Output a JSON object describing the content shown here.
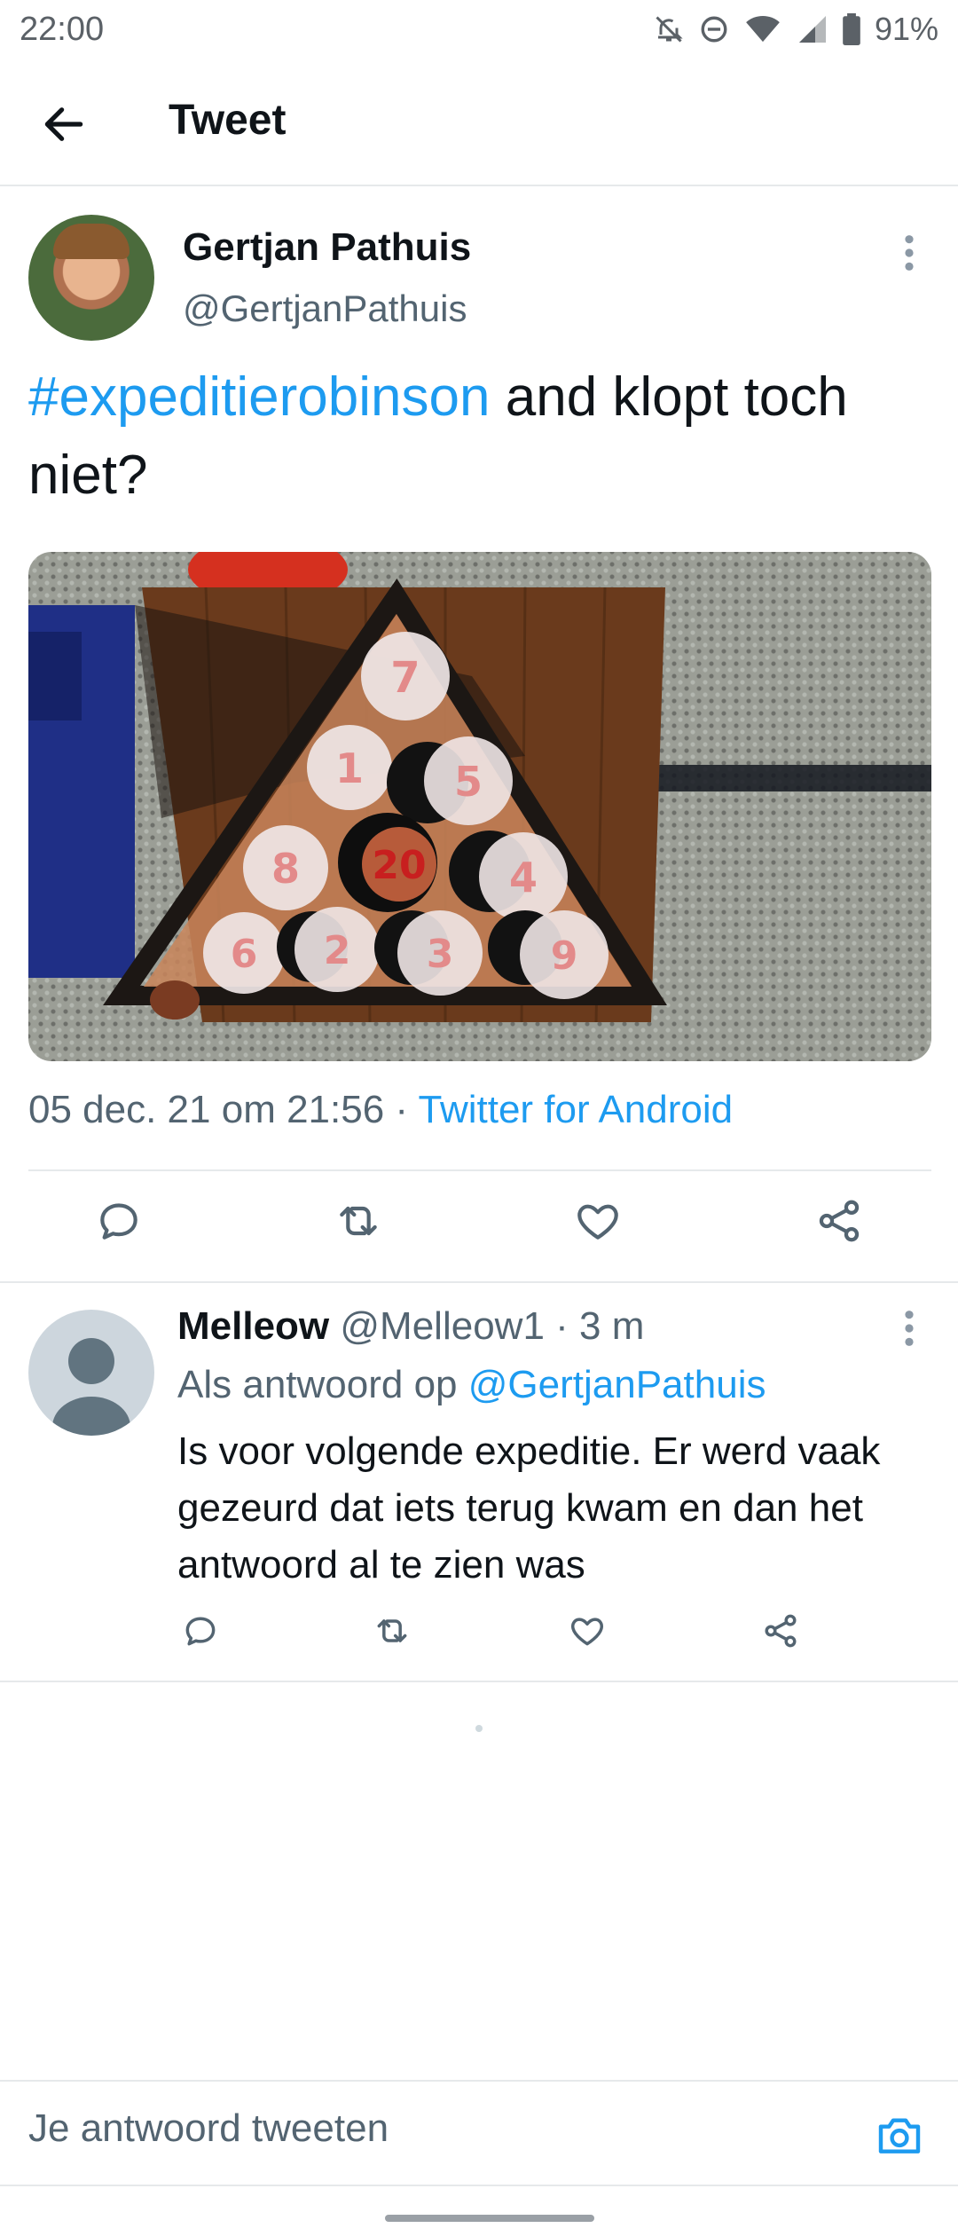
{
  "status_bar": {
    "time": "22:00",
    "icons": [
      "mute-icon",
      "dnd-icon",
      "wifi-icon",
      "signal-icon",
      "battery-icon"
    ],
    "battery": "91%"
  },
  "header": {
    "title": "Tweet",
    "back_icon": "arrow-left-icon"
  },
  "tweet": {
    "author_name": "Gertjan Pathuis",
    "author_handle": "@GertjanPathuis",
    "hashtag": "#expeditierobinson",
    "text_rest": " and klopt toch niet?",
    "media_numbers": [
      "7",
      "1",
      "5",
      "8",
      "20",
      "4",
      "6",
      "2",
      "3",
      "9"
    ],
    "date": "05 dec. 21 om 21:56",
    "separator": " · ",
    "source": "Twitter for Android"
  },
  "reply": {
    "name": "Melleow",
    "handle_time": " @Melleow1 · 3 m",
    "reply_to_label": "Als antwoord op ",
    "reply_to_handle": "@GertjanPathuis",
    "text": "Is voor volgende expeditie. Er werd vaak gezeurd dat iets terug kwam en dan het antwoord al te zien was"
  },
  "composer": {
    "placeholder": "Je antwoord tweeten",
    "camera_icon": "camera-icon"
  },
  "colors": {
    "accent": "#1d9bf0",
    "text": "#0f1419",
    "secondary": "#536471",
    "divider": "#e6e9eb"
  }
}
